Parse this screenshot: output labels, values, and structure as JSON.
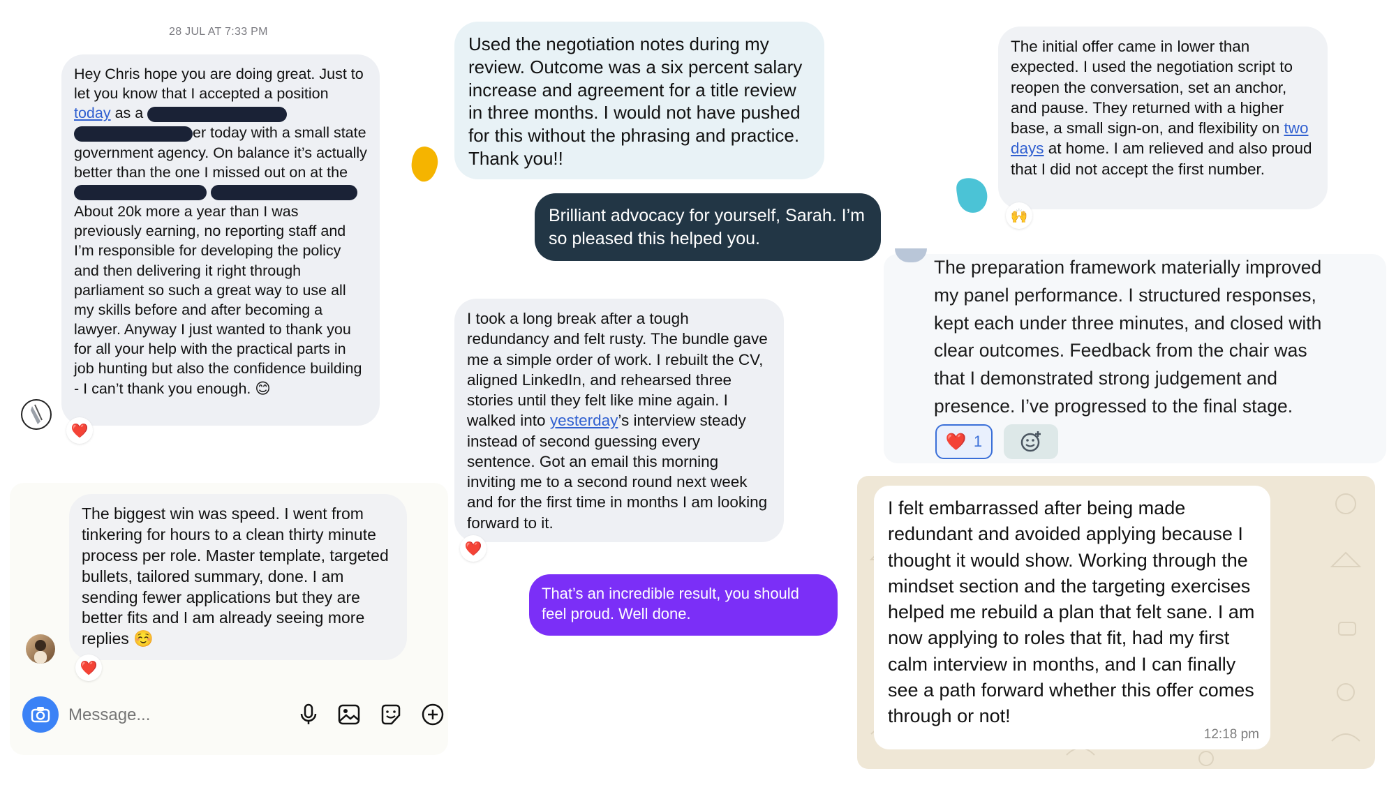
{
  "chat1": {
    "timestamp": "28 JUL AT 7:33 PM",
    "message": {
      "p1": "Hey Chris hope you are doing great. Just to let you know that I accepted a position ",
      "link": "today",
      "p2": " as a ",
      "p3": "er today with a small state government agency. On balance it’s actually better than the one I missed out on at the ",
      "p4": " About 20k more a year than I was previously earning, no reporting staff and I’m responsible for developing the policy and then delivering it right through parliament so such a great way to use all my skills before and after becoming a lawyer. Anyway I just wanted to thank you for all your help with the practical parts in job hunting but also the confidence building - I can’t thank you enough. ",
      "emoji": "😊"
    },
    "reaction": "❤️"
  },
  "chat2": {
    "message": "The biggest win was speed. I went from tinkering for hours to a clean thirty minute process per role. Master template, targeted bullets, tailored summary, done. I am sending fewer applications but they are better fits and I am already seeing more replies ",
    "emoji": "☺️",
    "reaction": "❤️",
    "composer": {
      "placeholder": "Message..."
    }
  },
  "chat3": {
    "incoming": "Used the negotiation notes during my review. Outcome was a six percent salary increase and agreement for a title review in three months. I would not have pushed for this without the phrasing and practice. Thank you!!",
    "outgoing": "Brilliant advocacy for yourself, Sarah. I’m so pleased this helped you."
  },
  "chat4": {
    "p1": "I took a long break after a tough redundancy and felt rusty. The bundle gave me a simple order of work. I rebuilt the CV, aligned LinkedIn, and rehearsed three stories until they felt like mine again. I walked into ",
    "link": "yesterday",
    "p2": "’s interview steady instead of second guessing every sentence. Got an email this morning inviting me to a second round next week and for the first time in months I am looking forward to it.",
    "reaction": "❤️",
    "reply": "That’s an incredible result, you should feel proud. Well done."
  },
  "chat5": {
    "p1": "The initial offer came in lower than expected. I used the negotiation script to reopen the conversation, set an anchor, and pause. They returned with a higher base, a small sign-on, and flexibility on ",
    "link": "two days",
    "p2": " at home. I am relieved and also proud that I did not accept the first number.",
    "reaction": "🙌"
  },
  "chat6": {
    "message": "The preparation framework materially improved my panel performance. I structured responses, kept each under three minutes, and closed with clear outcomes. Feedback from the chair was that I demonstrated strong judgement and presence. I’ve progressed to the final stage.",
    "reaction_emoji": "❤️",
    "reaction_count": "1"
  },
  "chat7": {
    "message": "I felt embarrassed after being made redundant and avoided applying because I thought it would show. Working through the mindset section and the targeting exercises helped me rebuild a plan that felt sane. I am now applying to roles that fit, had my first calm interview in months, and I can finally see a path forward whether this offer comes through or not!",
    "time": "12:18 pm"
  },
  "icons": {
    "camera": "camera-icon",
    "mic": "microphone-icon",
    "gallery": "image-icon",
    "sticker": "sticker-icon",
    "add": "plus-circle-icon",
    "add_reaction": "add-reaction-icon"
  },
  "colors": {
    "outgoing_dark": "#223645",
    "outgoing_purple": "#7b2ff7",
    "incoming_gray": "#eef0f4",
    "link": "#2f5fd0",
    "heart": "#e0245e",
    "camera_blue": "#3b82f6"
  }
}
